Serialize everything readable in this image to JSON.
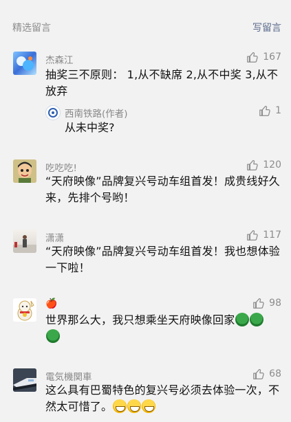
{
  "header": {
    "title": "精选留言",
    "write_label": "写留言"
  },
  "comments": [
    {
      "name": "杰森江",
      "likes": "167",
      "text": "抽奖三不原则： 1,从不缺席 2,从不中奖 3,从不放弃",
      "reply": {
        "name": "西南铁路(作者)",
        "likes": "1",
        "text": "从未中奖?"
      }
    },
    {
      "name": "吃吃吃!",
      "likes": "120",
      "text": "“天府映像”品牌复兴号动车组首发！成贵线好久来，先排个号哟！"
    },
    {
      "name": "潇潇",
      "likes": "117",
      "text": "“天府映像”品牌复兴号动车组首发！我也想体验一下啦！"
    },
    {
      "name": "🍎",
      "likes": "98",
      "text": "世界那么大，我只想乘坐天府映像回家"
    },
    {
      "name": "電気機関車",
      "likes": "68",
      "text": "这么具有巴蜀特色的复兴号必须去体验一次，不然太可惜了。"
    }
  ]
}
